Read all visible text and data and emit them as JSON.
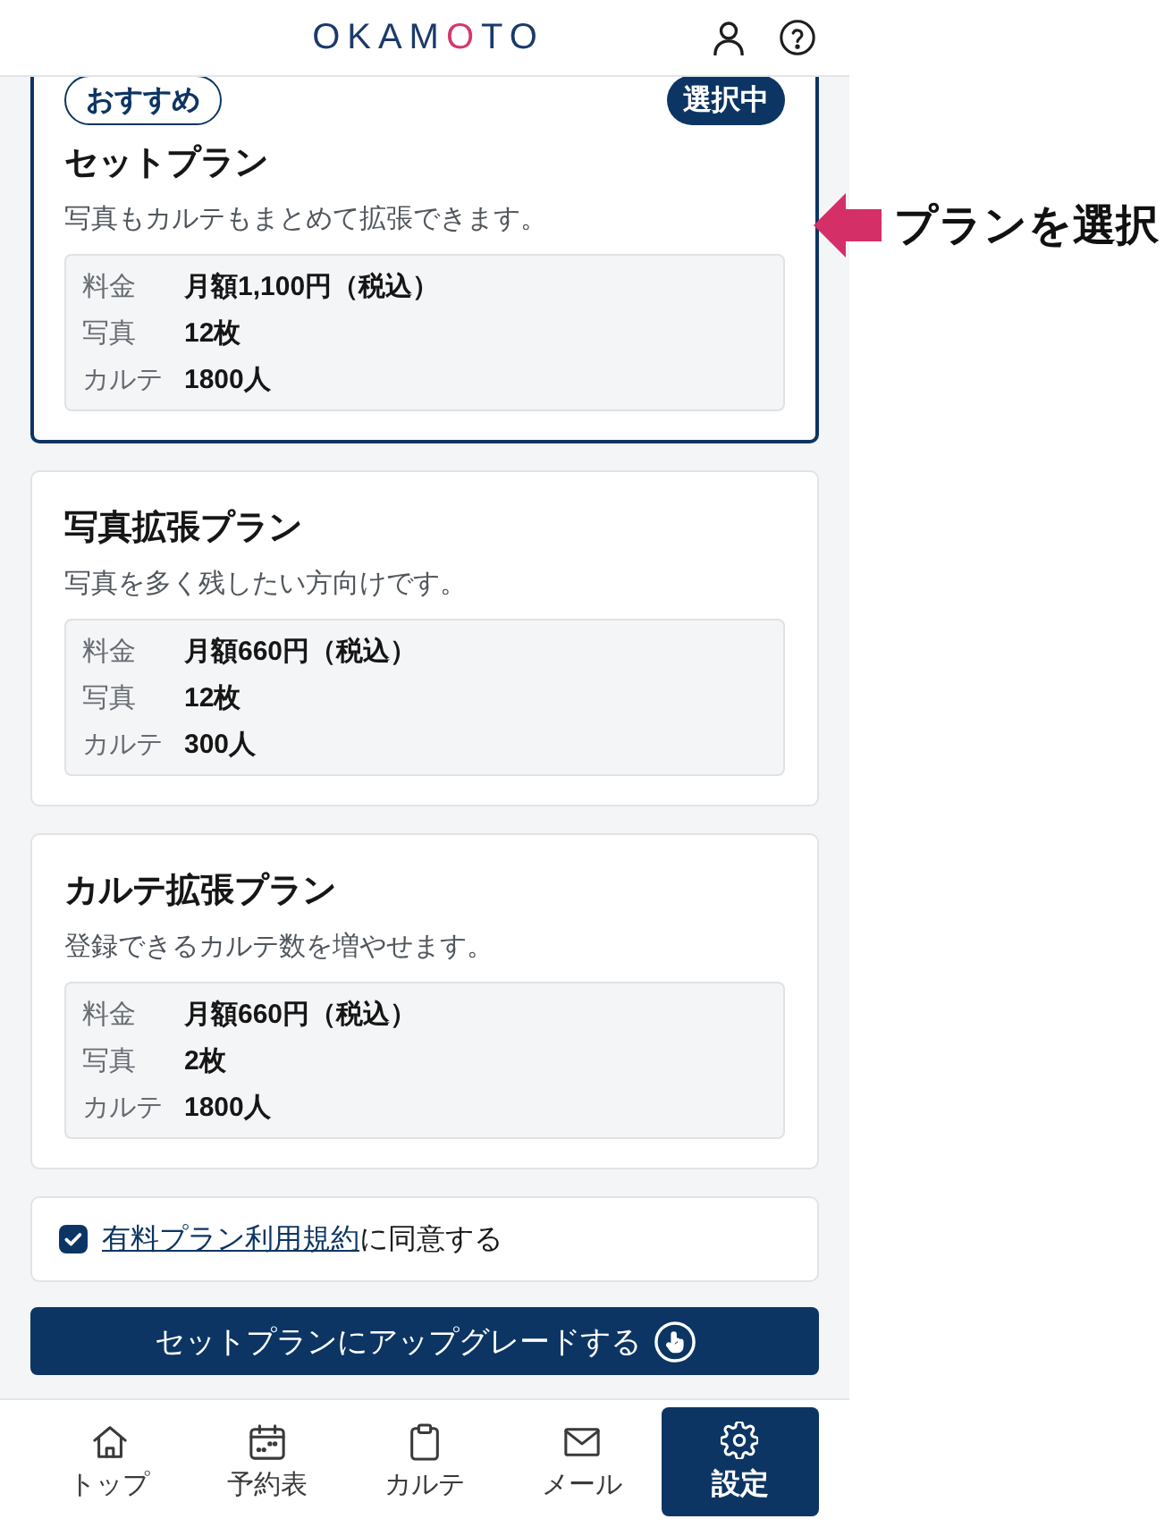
{
  "header": {
    "logo": "OKAMOTO"
  },
  "plans": [
    {
      "recommended_badge": "おすすめ",
      "status_badge": "選択中",
      "selected": true,
      "name": "セットプラン",
      "description": "写真もカルテもまとめて拡張できます。",
      "details": [
        {
          "label": "料金",
          "value": "月額1,100円（税込）"
        },
        {
          "label": "写真",
          "value": "12枚"
        },
        {
          "label": "カルテ",
          "value": "1800人"
        }
      ]
    },
    {
      "selected": false,
      "name": "写真拡張プラン",
      "description": "写真を多く残したい方向けです。",
      "details": [
        {
          "label": "料金",
          "value": "月額660円（税込）"
        },
        {
          "label": "写真",
          "value": "12枚"
        },
        {
          "label": "カルテ",
          "value": "300人"
        }
      ]
    },
    {
      "selected": false,
      "name": "カルテ拡張プラン",
      "description": "登録できるカルテ数を増やせます。",
      "details": [
        {
          "label": "料金",
          "value": "月額660円（税込）"
        },
        {
          "label": "写真",
          "value": "2枚"
        },
        {
          "label": "カルテ",
          "value": "1800人"
        }
      ]
    }
  ],
  "agreement": {
    "checked": true,
    "link": "有料プラン利用規約",
    "text": "に同意する"
  },
  "upgrade_button": {
    "label": "セットプランにアップグレードする"
  },
  "bottom_nav": [
    {
      "label": "トップ",
      "selected": false
    },
    {
      "label": "予約表",
      "selected": false
    },
    {
      "label": "カルテ",
      "selected": false
    },
    {
      "label": "メール",
      "selected": false
    },
    {
      "label": "設定",
      "selected": true
    }
  ],
  "annotation": {
    "label": "プランを選択"
  }
}
